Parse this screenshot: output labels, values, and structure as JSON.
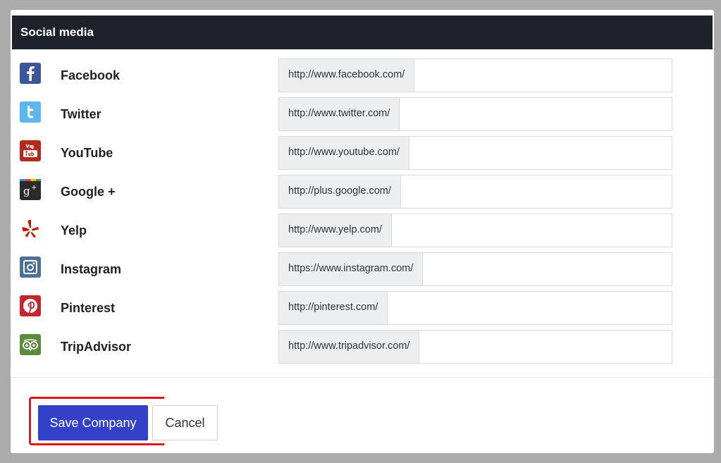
{
  "section_title": "Social media",
  "networks": [
    {
      "label": "Facebook",
      "prefix": "http://www.facebook.com/",
      "value": "",
      "icon": "facebook-icon",
      "color": "#3b5598"
    },
    {
      "label": "Twitter",
      "prefix": "http://www.twitter.com/",
      "value": "",
      "icon": "twitter-icon",
      "color": "#5eb6ee"
    },
    {
      "label": "YouTube",
      "prefix": "http://www.youtube.com/",
      "value": "",
      "icon": "youtube-icon",
      "color": "#b22a1f"
    },
    {
      "label": "Google +",
      "prefix": "http://plus.google.com/",
      "value": "",
      "icon": "google-plus-icon",
      "color": "#2a2a2a"
    },
    {
      "label": "Yelp",
      "prefix": "http://www.yelp.com/",
      "value": "",
      "icon": "yelp-icon",
      "color": "#c41200"
    },
    {
      "label": "Instagram",
      "prefix": "https://www.instagram.com/",
      "value": "",
      "icon": "instagram-icon",
      "color": "#4f6f96"
    },
    {
      "label": "Pinterest",
      "prefix": "http://pinterest.com/",
      "value": "",
      "icon": "pinterest-icon",
      "color": "#c4262d"
    },
    {
      "label": "TripAdvisor",
      "prefix": "http://www.tripadvisor.com/",
      "value": "",
      "icon": "tripadvisor-icon",
      "color": "#5d8a3c"
    }
  ],
  "actions": {
    "save_label": "Save Company",
    "cancel_label": "Cancel"
  },
  "colors": {
    "header_bg": "#1d222b",
    "save_button": "#3341c9",
    "highlight": "#e4141a"
  }
}
